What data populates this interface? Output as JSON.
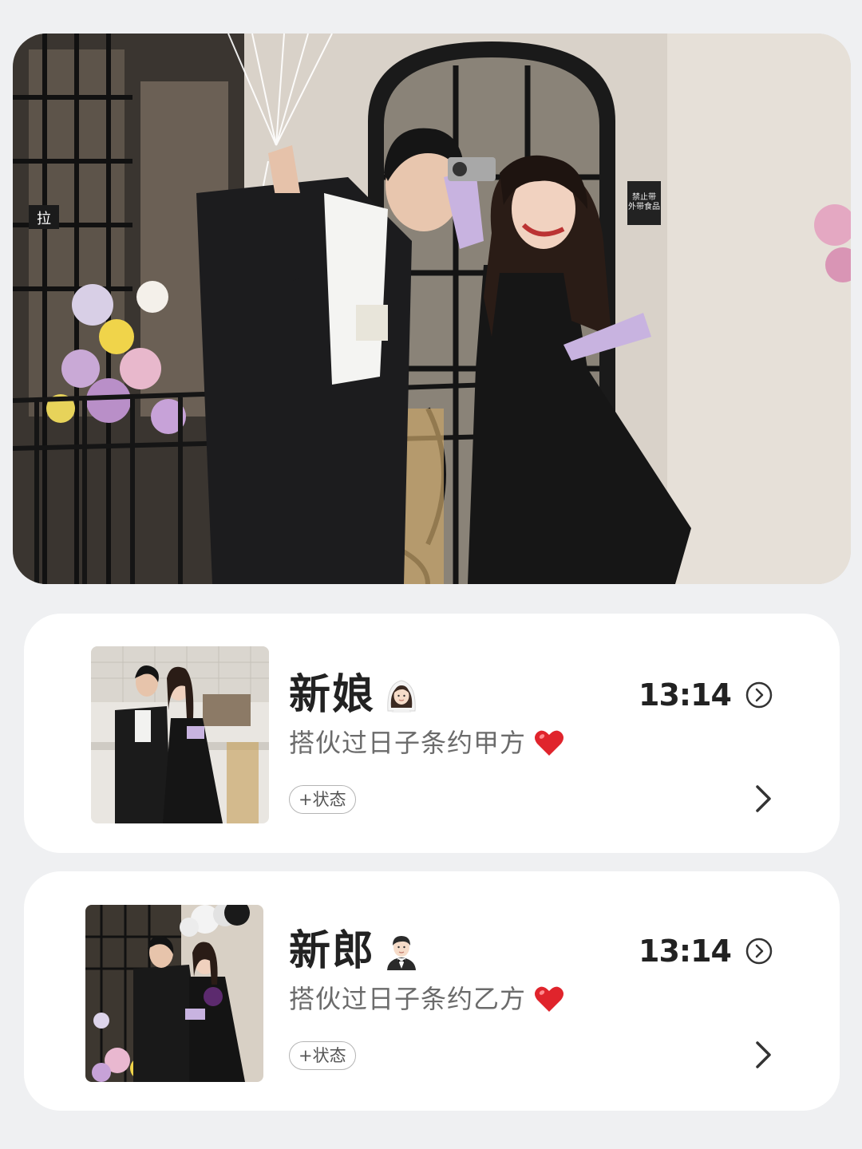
{
  "hero": {
    "image": "couple-photo-black-outfits-balloons-camera",
    "shop_sign": "禁止带\n外带食品",
    "door_sign": "拉"
  },
  "cards": [
    {
      "name": "新娘",
      "emoji": "bride-with-veil-emoji",
      "subtitle": "搭伙过日子条约甲方",
      "heart": "red-heart-emoji",
      "status": "+状态",
      "time": "13:14",
      "thumbnail": "bride-groom-kitchen-photo"
    },
    {
      "name": "新郎",
      "emoji": "groom-in-tuxedo-emoji",
      "subtitle": "搭伙过日子条约乙方",
      "heart": "red-heart-emoji",
      "status": "+状态",
      "time": "13:14",
      "thumbnail": "groom-bride-balloons-photo"
    }
  ],
  "colors": {
    "background": "#eff0f2",
    "card": "#ffffff",
    "heart": "#e0242c",
    "text_primary": "#222222",
    "text_secondary": "#6b6b6b"
  }
}
